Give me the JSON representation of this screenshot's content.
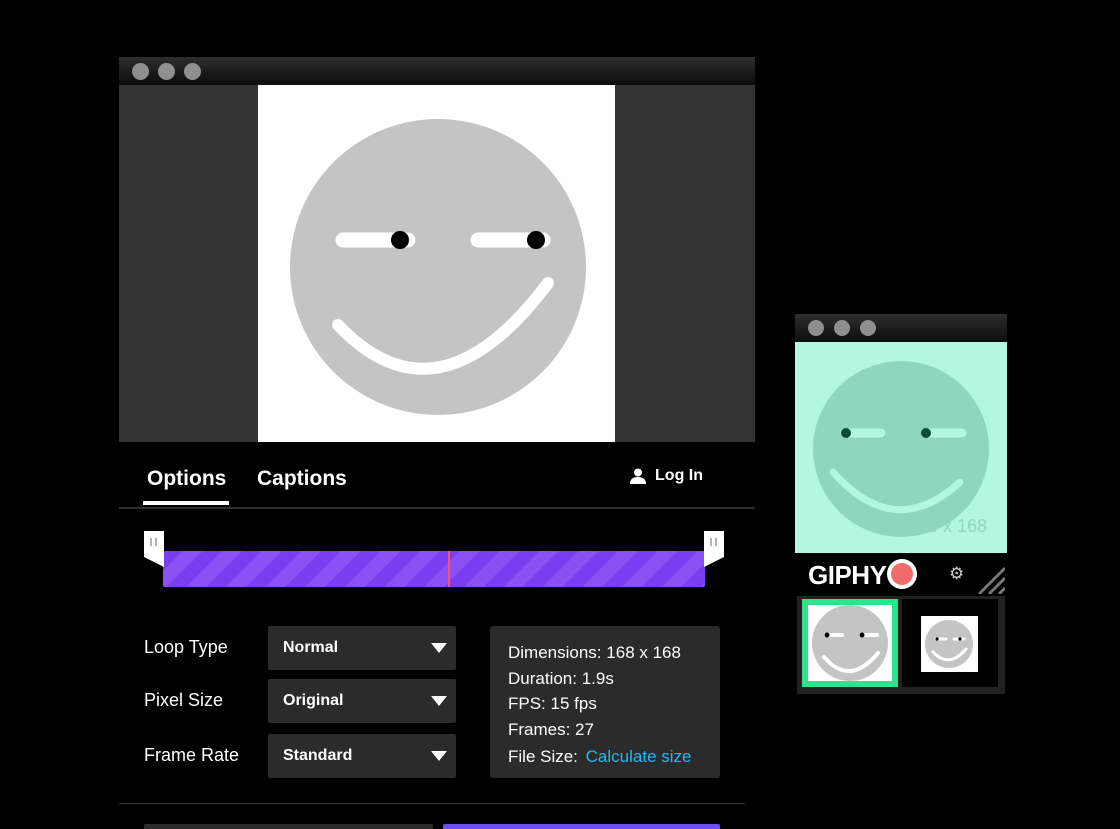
{
  "editor": {
    "tabs": [
      "Options",
      "Captions"
    ],
    "login_label": "Log In",
    "options": {
      "loop_type_label": "Loop Type",
      "loop_type_value": "Normal",
      "pixel_size_label": "Pixel Size",
      "pixel_size_value": "Original",
      "frame_rate_label": "Frame Rate",
      "frame_rate_value": "Standard"
    },
    "info": {
      "dimensions_label": "Dimensions:",
      "dimensions_value": "168 x 168",
      "duration": "Duration: 1.9s",
      "fps": "FPS: 15 fps",
      "frames": "Frames: 27",
      "file_size_label": "File Size:",
      "file_size_link": "Calculate size"
    }
  },
  "capture": {
    "size_label": "168 x 168",
    "brand": "GIPHY"
  },
  "colors": {
    "timeline": "#7a3df0",
    "playhead": "#ff4f6e",
    "link": "#22b8f0",
    "mini_preview": "#b2f7e0",
    "selected_frame": "#2fe38c",
    "record": "#f26b6b"
  },
  "icons": [
    "window-close-dot",
    "window-minimize-dot",
    "window-zoom-dot",
    "user-icon",
    "chevron-down-icon",
    "record-icon",
    "gear-icon",
    "resize-handle-icon"
  ]
}
